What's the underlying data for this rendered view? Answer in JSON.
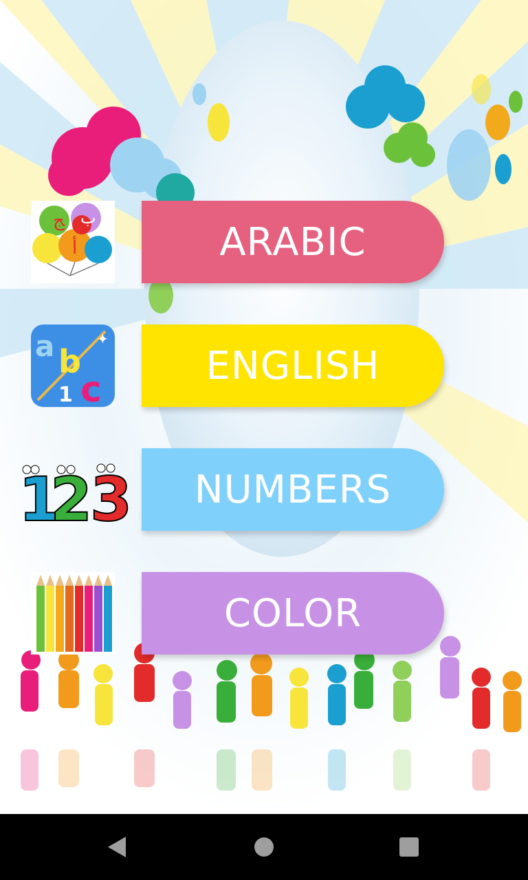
{
  "menu": {
    "items": [
      {
        "label": "ARABIC",
        "color": "#e6607f",
        "icon": "arabic-letters-balloons-icon"
      },
      {
        "label": "ENGLISH",
        "color": "#ffe400",
        "icon": "abc-blocks-icon"
      },
      {
        "label": "NUMBERS",
        "color": "#7fd1fb",
        "icon": "cartoon-123-icon"
      },
      {
        "label": "COLOR",
        "color": "#c792e6",
        "icon": "colored-pencils-icon"
      }
    ]
  },
  "icons": {
    "abc_a": "a",
    "abc_b": "b",
    "abc_c": "c",
    "abc_1": "1",
    "num_1": "1",
    "num_2": "2",
    "num_3": "3"
  },
  "navigation": {
    "back": "back-triangle-icon",
    "home": "home-circle-icon",
    "recents": "recents-square-icon",
    "background": "#000000"
  }
}
